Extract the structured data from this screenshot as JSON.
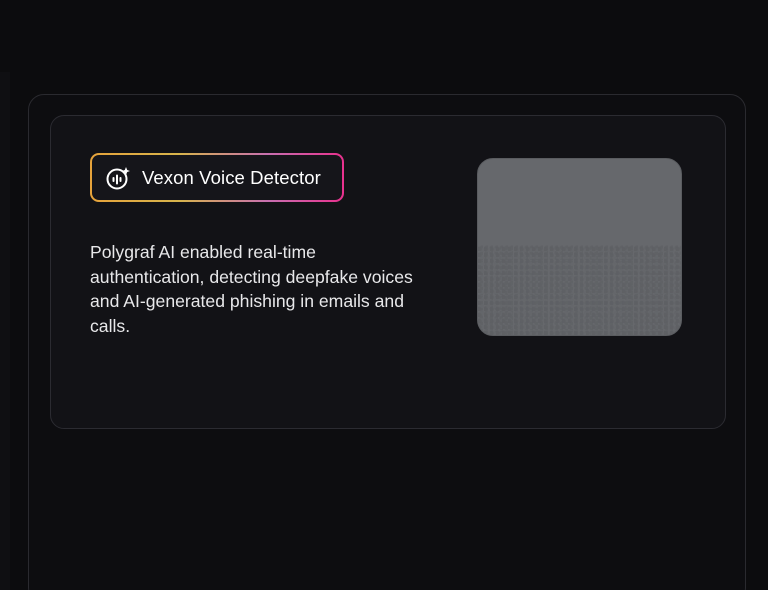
{
  "card": {
    "badge_label": "Vexon Voice Detector",
    "badge_icon": "ai-voice-icon",
    "description": "Polygraf AI enabled real-time authentication, detecting deepfake voices and AI-generated phishing in emails and calls."
  },
  "colors": {
    "background": "#0c0c0e",
    "card_background": "#121216",
    "badge_gradient": [
      "#e6a33b",
      "#d7b44c",
      "#c86fb0",
      "#e8318e"
    ],
    "preview_gray": "#66686c"
  }
}
